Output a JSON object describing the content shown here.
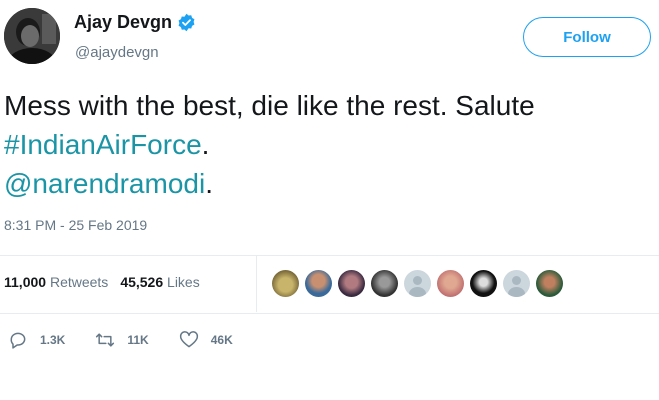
{
  "user": {
    "name": "Ajay Devgn",
    "handle": "@ajaydevgn",
    "verified": true,
    "avatar_icon": "profile-photo"
  },
  "follow_button": {
    "label": "Follow"
  },
  "tweet": {
    "text_plain": "Mess with the best, die like the rest. Salute ",
    "hashtag": "#IndianAirForce",
    "period1": ".",
    "mention": "@narendramodi",
    "period2": ".",
    "timestamp": "8:31 PM - 25 Feb 2019"
  },
  "stats": {
    "retweets_count": "11,000",
    "retweets_label": "Retweets",
    "likes_count": "45,526",
    "likes_label": "Likes"
  },
  "liker_faces": [
    "face-1",
    "face-2",
    "face-3",
    "face-4",
    "face-default",
    "face-6",
    "face-7",
    "face-default",
    "face-9"
  ],
  "actions": {
    "reply_count": "1.3K",
    "retweet_count": "11K",
    "like_count": "46K"
  },
  "colors": {
    "accent": "#1da1f2",
    "link": "#1b95a6",
    "muted": "#657786",
    "text": "#14171a"
  }
}
